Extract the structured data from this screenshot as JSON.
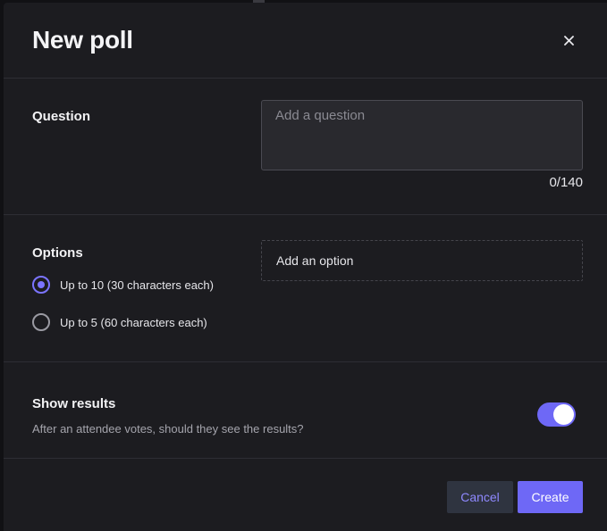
{
  "dialog": {
    "title": "New poll",
    "close_icon": "close-icon"
  },
  "question": {
    "label": "Question",
    "placeholder": "Add a question",
    "value": "",
    "counter": "0/140"
  },
  "options": {
    "label": "Options",
    "input_placeholder": "Add an option",
    "choices": [
      {
        "label": "Up to 10 (30 characters each)",
        "selected": true
      },
      {
        "label": "Up to 5 (60 characters each)",
        "selected": false
      }
    ]
  },
  "results": {
    "label": "Show results",
    "help": "After an attendee votes, should they see the results?",
    "enabled": true
  },
  "footer": {
    "cancel_label": "Cancel",
    "create_label": "Create"
  },
  "colors": {
    "accent": "#6e68f6",
    "background": "#1c1c20"
  }
}
